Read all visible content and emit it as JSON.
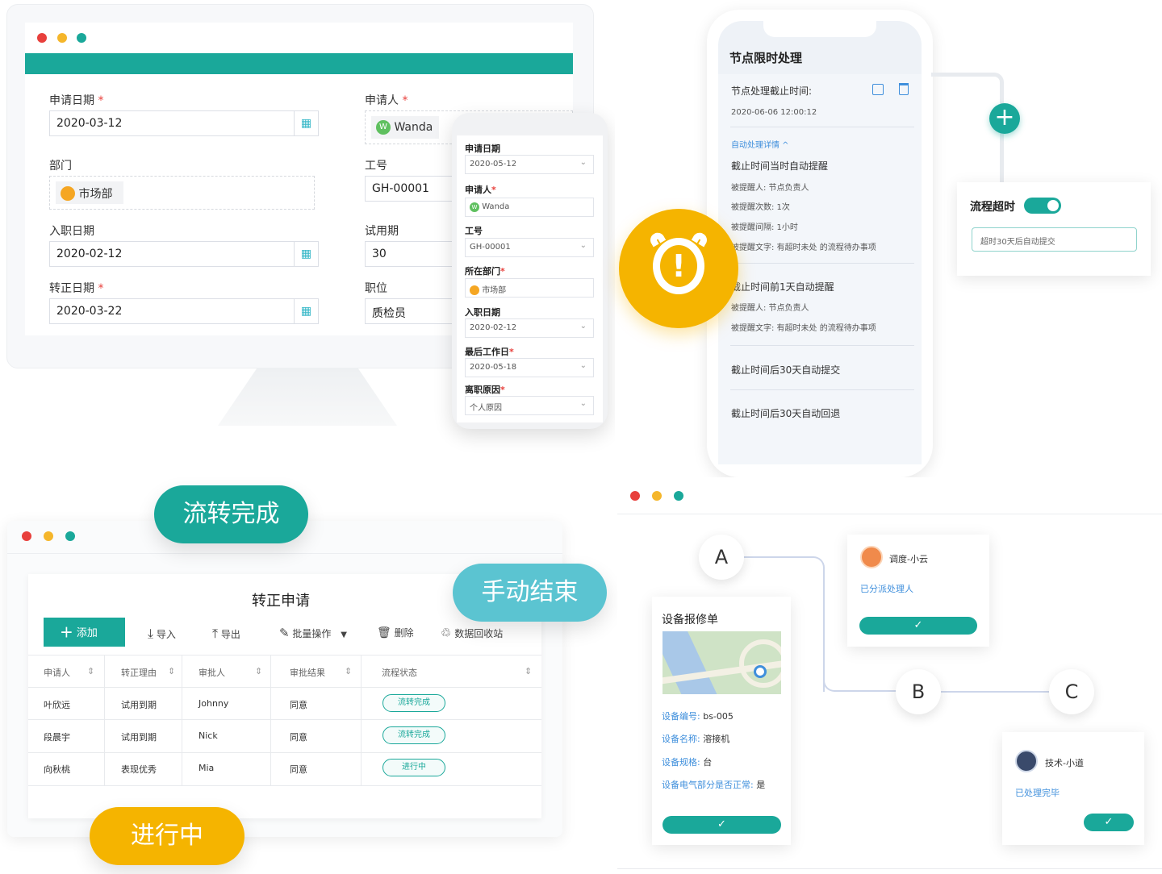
{
  "form": {
    "apply_date_label": "申请日期",
    "apply_date_value": "2020-03-12",
    "applicant_label": "申请人",
    "applicant_value": "Wanda",
    "applicant_avatar": "W",
    "dept_label": "部门",
    "dept_value": "市场部",
    "job_no_label": "工号",
    "job_no_value": "GH-00001",
    "entry_label": "入职日期",
    "entry_value": "2020-02-12",
    "probation_label": "试用期",
    "probation_value": "30",
    "regular_label": "转正日期",
    "regular_value": "2020-03-22",
    "position_label": "职位",
    "position_value": "质检员",
    "required_mark": "*"
  },
  "mobile_form": {
    "apply_date_label": "申请日期",
    "apply_date_value": "2020-05-12",
    "applicant_label": "申请人",
    "applicant_value": "Wanda",
    "applicant_avatar": "W",
    "job_no_label": "工号",
    "job_no_value": "GH-00001",
    "dept_label": "所在部门",
    "dept_value": "市场部",
    "entry_label": "入职日期",
    "entry_value": "2020-02-12",
    "last_day_label": "最后工作日",
    "last_day_value": "2020-05-18",
    "reason_label": "离职原因",
    "reason_value": "个人原因"
  },
  "node_limit": {
    "title": "节点限时处理",
    "deadline_label": "节点处理截止时间:",
    "deadline_value": "2020-06-06 12:00:12",
    "auto_detail": "自动处理详情",
    "rule1_title": "截止时间当时自动提醒",
    "rule1_who": "被提醒人: 节点负责人",
    "rule1_times": "被提醒次数: 1次",
    "rule1_interval": "被提醒间隔: 1小时",
    "rule1_text": "被提醒文字: 有超时未处 的流程待办事项",
    "rule2_title": "截止时间前1天自动提醒",
    "rule2_who": "被提醒人: 节点负责人",
    "rule2_text": "被提醒文字: 有超时未处 的流程待办事项",
    "rule3_title": "截止时间后30天自动提交",
    "rule4_title": "截止时间后30天自动回退"
  },
  "timeout_card": {
    "label": "流程超时",
    "input_value": "超时30天后自动提交",
    "toggle_on": true
  },
  "pills": {
    "done": "流转完成",
    "manual": "手动结束",
    "progress": "进行中"
  },
  "colors": {
    "teal": "#1aa89a",
    "sky": "#5bc4d1",
    "amber": "#f5b400",
    "link": "#3f8fdc"
  },
  "table": {
    "title": "转正申请",
    "toolbar": {
      "add": "添加",
      "import": "导入",
      "export": "导出",
      "batch": "批量操作",
      "delete": "删除",
      "recycle": "数据回收站"
    },
    "headers": [
      "申请人",
      "转正理由",
      "审批人",
      "审批结果",
      "流程状态"
    ],
    "rows": [
      [
        "叶欣远",
        "试用到期",
        "Johnny",
        "同意",
        "流转完成"
      ],
      [
        "段晨宇",
        "试用到期",
        "Nick",
        "同意",
        "流转完成"
      ],
      [
        "向秋桃",
        "表现优秀",
        "Mia",
        "同意",
        "进行中"
      ]
    ]
  },
  "flow": {
    "node_a": "A",
    "node_b": "B",
    "node_c": "C",
    "repair_title": "设备报修单",
    "fields": [
      {
        "label": "设备编号:",
        "value": "bs-005"
      },
      {
        "label": "设备名称:",
        "value": "溶接机"
      },
      {
        "label": "设备规格:",
        "value": "台"
      },
      {
        "label": "设备电气部分是否正常:",
        "value": "是"
      }
    ],
    "dispatcher_name": "调度-小云",
    "dispatcher_status": "已分派处理人",
    "tech_name": "技术-小道",
    "tech_status": "已处理完毕"
  },
  "icons": {
    "check": "✓",
    "plus": "+",
    "calendar": "▦",
    "chevron": "⌄",
    "sort": "⇕",
    "alarm": "!"
  }
}
